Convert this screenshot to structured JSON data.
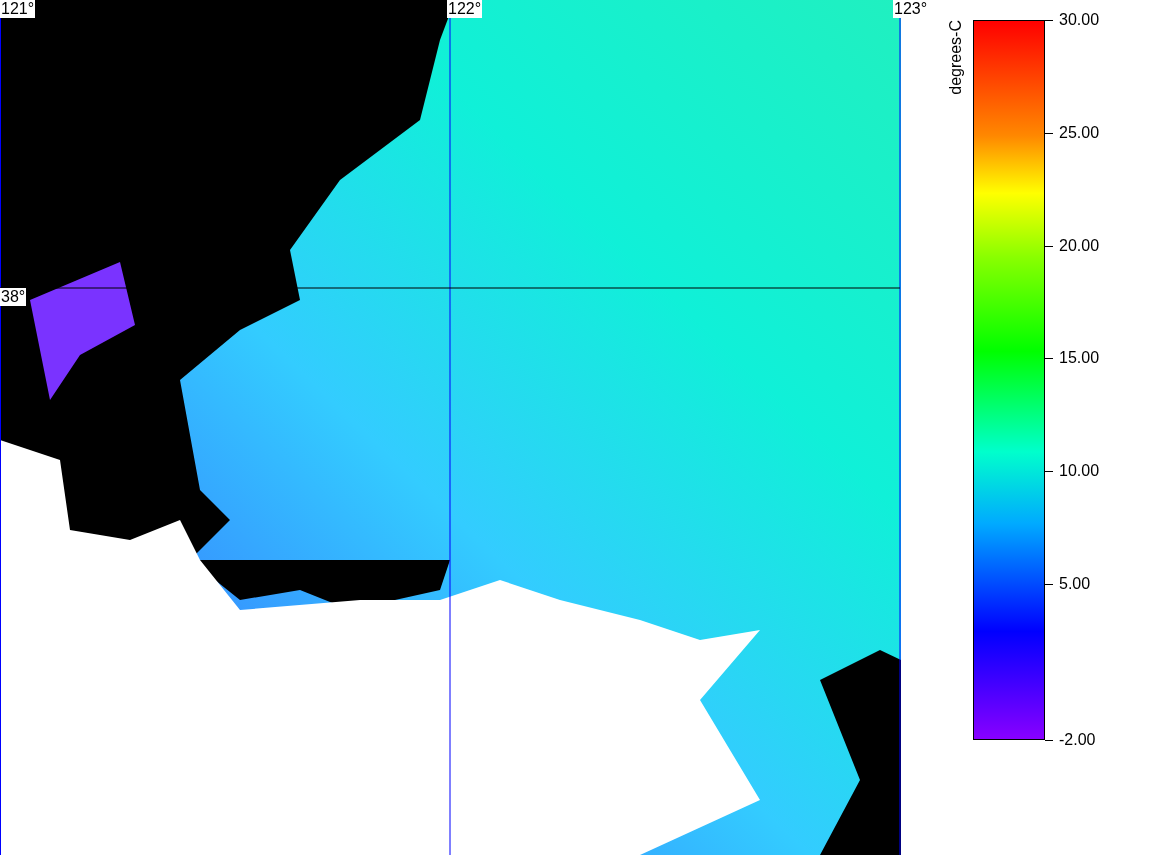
{
  "map": {
    "lon_labels": [
      "121°",
      "122°",
      "123°"
    ],
    "lat_labels": [
      "38°"
    ]
  },
  "colorbar": {
    "title": "degrees-C",
    "ticks": [
      "30.00",
      "25.00",
      "20.00",
      "15.00",
      "10.00",
      "5.00",
      "-2.00"
    ]
  }
}
